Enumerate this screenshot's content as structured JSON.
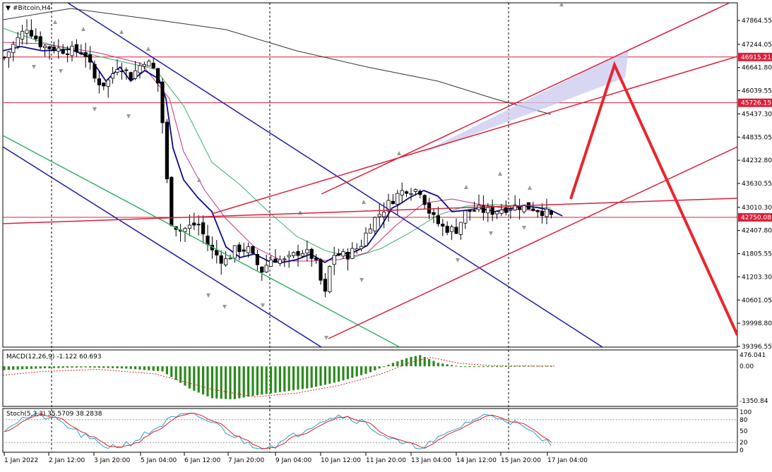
{
  "symbol_title": "#Bitcoin,H4",
  "panels": {
    "macd": {
      "label": "MACD(12,26,9) -1.122 60.693",
      "ticks": [
        "476.041",
        "0.00",
        "-1350.84"
      ]
    },
    "stoch": {
      "label": "Stoch(5,3,3) 35.5709 38.2838",
      "ticks": [
        "100",
        "80",
        "50",
        "20",
        "0"
      ]
    }
  },
  "price_ticks": [
    "47864.55",
    "47244.05",
    "46641.80",
    "46039.55",
    "45437.30",
    "44835.05",
    "44232.80",
    "43630.55",
    "43010.30",
    "42407.80",
    "41805.55",
    "41203.30",
    "40601.05",
    "39998.80",
    "39396.55"
  ],
  "price_tags": [
    {
      "value": "46915.21",
      "color": "#d9213b"
    },
    {
      "value": "45726.15",
      "color": "#d9213b"
    },
    {
      "value": "42750.08",
      "color": "#d9213b"
    }
  ],
  "time_ticks": [
    "1 Jan 2022",
    "2 Jan 12:00",
    "3 Jan 20:00",
    "5 Jan 04:00",
    "6 Jan 12:00",
    "7 Jan 20:00",
    "9 Jan 04:00",
    "10 Jan 12:00",
    "11 Jan 20:00",
    "13 Jan 04:00",
    "14 Jan 12:00",
    "15 Jan 20:00",
    "17 Jan 04:00"
  ],
  "colors": {
    "bull": "#ffffff",
    "bear": "#000000",
    "channel_blue": "#1a1aa8",
    "channel_green": "#3cb06a",
    "fib_red": "#d9213b",
    "arrow_red": "#e8262c",
    "macd_bar": "#2a8a1c",
    "macd_signal": "#e02020",
    "stoch_main": "#2aa0d0",
    "stoch_signal": "#e02020"
  },
  "chart_data": [
    {
      "type": "candlestick",
      "title": "#Bitcoin,H4",
      "ylim": [
        39396.55,
        48200
      ],
      "x": [
        "1 Jan 2022",
        "2 Jan 12:00",
        "3 Jan 20:00",
        "5 Jan 04:00",
        "6 Jan 12:00",
        "7 Jan 20:00",
        "9 Jan 04:00",
        "10 Jan 12:00",
        "11 Jan 20:00",
        "13 Jan 04:00",
        "14 Jan 12:00",
        "15 Jan 20:00",
        "17 Jan 04:00"
      ],
      "close_approx": [
        47100,
        47250,
        46300,
        46900,
        42700,
        41800,
        41600,
        41200,
        43300,
        42500,
        43050,
        43000,
        42750
      ],
      "levels": [
        46915.21,
        45726.15,
        42750.08
      ]
    },
    {
      "type": "bar",
      "title": "MACD(12,26,9) -1.122 60.693",
      "ylim": [
        -1350.84,
        476.041
      ]
    },
    {
      "type": "line",
      "title": "Stoch(5,3,3) 35.5709 38.2838",
      "ylim": [
        0,
        100
      ]
    }
  ]
}
